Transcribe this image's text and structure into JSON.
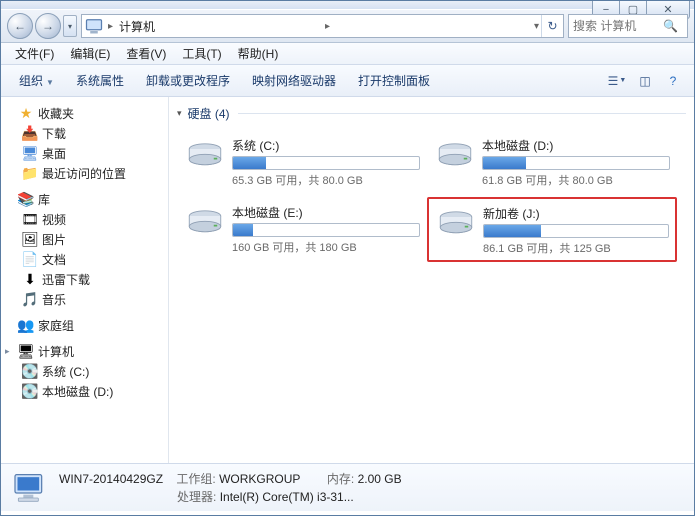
{
  "window": {
    "min": "−",
    "max": "▢",
    "close": "✕"
  },
  "nav": {
    "back_arrow": "←",
    "fwd_arrow": "→",
    "location": "计算机",
    "sep": "▸",
    "refresh": "↻",
    "dropdown": "▾"
  },
  "search": {
    "placeholder": "搜索 计算机"
  },
  "menu": {
    "file": "文件(F)",
    "edit": "编辑(E)",
    "view": "查看(V)",
    "tools": "工具(T)",
    "help": "帮助(H)"
  },
  "toolbar": {
    "organize": "组织",
    "sysprops": "系统属性",
    "uninstall": "卸载或更改程序",
    "mapdrive": "映射网络驱动器",
    "controlpanel": "打开控制面板"
  },
  "sidebar": {
    "favorites": {
      "label": "收藏夹",
      "items": [
        "下载",
        "桌面",
        "最近访问的位置"
      ]
    },
    "libraries": {
      "label": "库",
      "items": [
        "视频",
        "图片",
        "文档",
        "迅雷下载",
        "音乐"
      ]
    },
    "homegroup": "家庭组",
    "computer": {
      "label": "计算机",
      "items": [
        "系统 (C:)",
        "本地磁盘 (D:)"
      ]
    }
  },
  "content": {
    "group_label": "硬盘 (4)",
    "drives": [
      {
        "name": "系统 (C:)",
        "free": "65.3 GB 可用，共 80.0 GB",
        "fill_pct": 18,
        "highlight": false
      },
      {
        "name": "本地磁盘 (D:)",
        "free": "61.8 GB 可用，共 80.0 GB",
        "fill_pct": 23,
        "highlight": false
      },
      {
        "name": "本地磁盘 (E:)",
        "free": "160 GB 可用，共 180 GB",
        "fill_pct": 11,
        "highlight": false
      },
      {
        "name": "新加卷 (J:)",
        "free": "86.1 GB 可用，共 125 GB",
        "fill_pct": 31,
        "highlight": true
      }
    ]
  },
  "status": {
    "name": "WIN7-20140429GZ",
    "workgroup_label": "工作组:",
    "workgroup": "WORKGROUP",
    "mem_label": "内存:",
    "mem": "2.00 GB",
    "cpu_label": "处理器:",
    "cpu": "Intel(R) Core(TM) i3-31..."
  }
}
